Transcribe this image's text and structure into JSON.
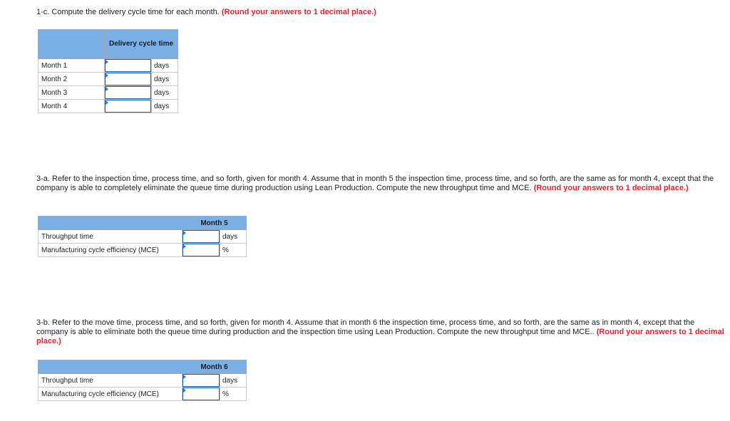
{
  "q1": {
    "prompt": "1-c. Compute the delivery cycle time for each month. ",
    "instruction": "(Round your answers to 1 decimal place.)",
    "table": {
      "header_blank": "",
      "header": "Delivery cycle time",
      "rows": [
        {
          "label": "Month 1",
          "value": "",
          "unit": "days"
        },
        {
          "label": "Month 2",
          "value": "",
          "unit": "days"
        },
        {
          "label": "Month 3",
          "value": "",
          "unit": "days"
        },
        {
          "label": "Month 4",
          "value": "",
          "unit": "days"
        }
      ]
    }
  },
  "q2": {
    "prompt": "3-a. Refer to the inspection time, process time, and so forth, given for month 4. Assume that in month 5 the inspection time, process time, and so forth, are the same as for month 4, except that the company is able to completely eliminate the queue time during production using Lean Production. Compute the new throughput time and MCE. ",
    "instruction": "(Round your answers to 1 decimal place.)",
    "table": {
      "header_blank": "",
      "header": "Month 5",
      "rows": [
        {
          "label": "Throughput time",
          "value": "",
          "unit": "days"
        },
        {
          "label": "Manufacturing cycle efficiency (MCE)",
          "value": "",
          "unit": "%"
        }
      ]
    }
  },
  "q3": {
    "prompt": "3-b. Refer to the move time, process time, and so forth, given for month 4. Assume that in month 6 the inspection time, process time, and so forth, are the same as in month 4, except that the company is able to eliminate both the queue time during production and the inspection time using Lean Production. Compute the new throughput time and MCE.. ",
    "instruction": "(Round your answers to 1 decimal place.)",
    "table": {
      "header_blank": "",
      "header": "Month 6",
      "rows": [
        {
          "label": "Throughput time",
          "value": "",
          "unit": "days"
        },
        {
          "label": "Manufacturing cycle efficiency (MCE)",
          "value": "",
          "unit": "%"
        }
      ]
    }
  },
  "colors": {
    "header_bg": "#7bb0e6",
    "instruction_red": "#e5232f",
    "input_border": "#1f5ea8"
  }
}
